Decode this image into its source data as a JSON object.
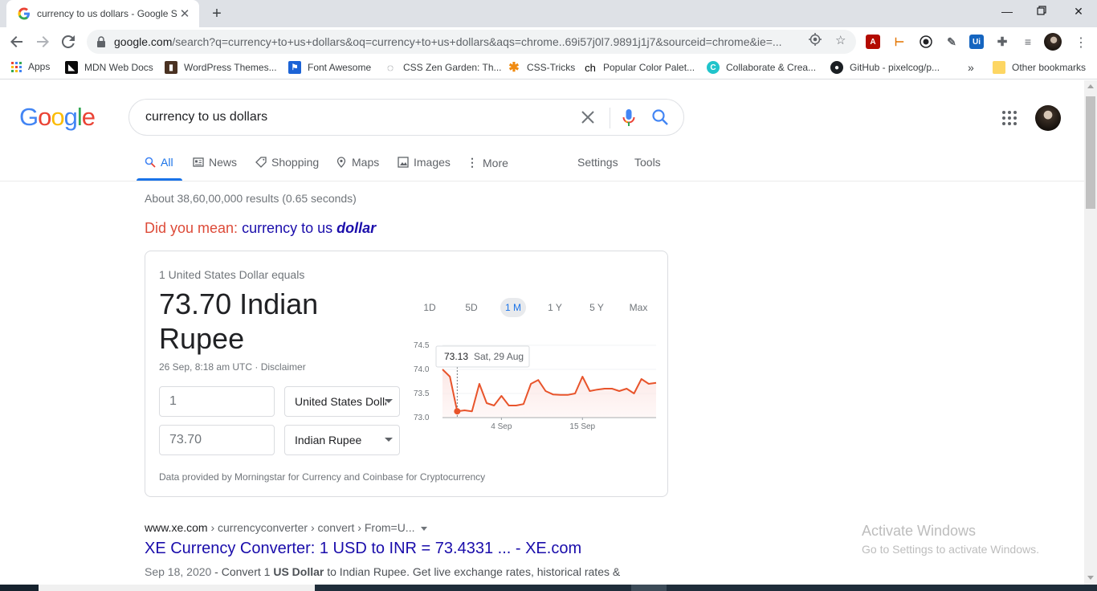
{
  "browser": {
    "tab_title": "currency to us dollars - Google S",
    "url_host": "google.com",
    "url_path": "/search?q=currency+to+us+dollars&oq=currency+to+us+dollars&aqs=chrome..69i57j0l7.9891j1j7&sourceid=chrome&ie=..."
  },
  "bookmarks": [
    {
      "label": "Apps",
      "icon": "apps-grid-icon"
    },
    {
      "label": "MDN Web Docs",
      "icon": "mdn-icon"
    },
    {
      "label": "WordPress Themes...",
      "icon": "wordpress-icon"
    },
    {
      "label": "Font Awesome",
      "icon": "flag-icon"
    },
    {
      "label": "CSS Zen Garden: Th...",
      "icon": "zen-garden-icon"
    },
    {
      "label": "CSS-Tricks",
      "icon": "asterisk-icon"
    },
    {
      "label": "Popular Color Palet...",
      "icon": "ch-icon"
    },
    {
      "label": "Collaborate & Crea...",
      "icon": "canva-icon"
    },
    {
      "label": "GitHub - pixelcog/p...",
      "icon": "github-icon"
    }
  ],
  "bookmarks_more": "»",
  "other_bookmarks": "Other bookmarks",
  "google": {
    "logo": [
      "G",
      "o",
      "o",
      "g",
      "l",
      "e"
    ],
    "query": "currency to us dollars",
    "nav": {
      "all": "All",
      "news": "News",
      "shopping": "Shopping",
      "maps": "Maps",
      "images": "Images",
      "more": "More",
      "settings": "Settings",
      "tools": "Tools"
    },
    "stats": "About 38,60,00,000 results (0.65 seconds)",
    "did_you_mean_label": "Did you mean: ",
    "did_you_mean_plain": "currency to us ",
    "did_you_mean_bold": "dollar"
  },
  "converter": {
    "equals": "1 United States Dollar equals",
    "result": "73.70 Indian Rupee",
    "timestamp": "26 Sep, 8:18 am UTC · Disclaimer",
    "from_value": "1",
    "from_currency": "United States Dollar",
    "to_value": "73.70",
    "to_currency": "Indian Rupee",
    "provided_by": "Data provided by Morningstar for Currency and Coinbase for Cryptocurrency",
    "ranges": [
      "1D",
      "5D",
      "1 M",
      "1 Y",
      "5 Y",
      "Max"
    ],
    "active_range": "1 M",
    "tooltip_value": "73.13",
    "tooltip_date": "Sat, 29 Aug"
  },
  "chart_data": {
    "type": "line",
    "y_ticks": [
      "74.5",
      "74.0",
      "73.5",
      "73.0"
    ],
    "ylim": [
      73.0,
      74.5
    ],
    "x_tick_labels": [
      "4 Sep",
      "15 Sep"
    ],
    "x_tick_positions": [
      8,
      19
    ],
    "series": [
      {
        "values": [
          74.0,
          73.85,
          73.13,
          73.15,
          73.13,
          73.7,
          73.3,
          73.25,
          73.45,
          73.25,
          73.25,
          73.28,
          73.7,
          73.78,
          73.55,
          73.48,
          73.47,
          73.47,
          73.5,
          73.85,
          73.55,
          73.58,
          73.6,
          73.6,
          73.55,
          73.6,
          73.5,
          73.8,
          73.7,
          73.72
        ],
        "color": "#e8542b"
      }
    ],
    "highlight_index": 2,
    "grid": true
  },
  "result": {
    "cite_host": "www.xe.com",
    "cite_path": " › currencyconverter › convert › From=U...",
    "title": "XE Currency Converter: 1 USD to INR = 73.4331 ... - XE.com",
    "date": "Sep 18, 2020",
    "snippet_pre": " - Convert 1 ",
    "snippet_bold": "US Dollar",
    "snippet_post": " to Indian Rupee. Get live exchange rates, historical rates &"
  },
  "watermark": {
    "line1": "Activate Windows",
    "line2": "Go to Settings to activate Windows."
  },
  "colors": {
    "accent_blue": "#1a73e8",
    "link": "#1a0dab",
    "chart_line": "#e8542b",
    "did_you_mean": "#dd4b39"
  }
}
